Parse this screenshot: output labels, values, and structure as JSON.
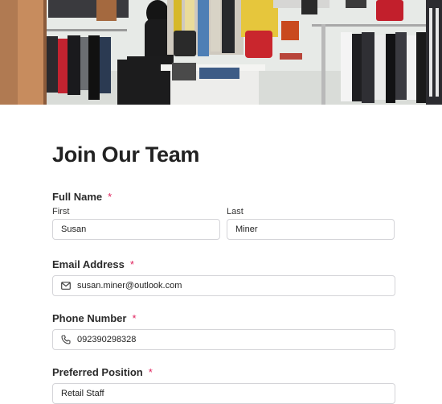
{
  "form": {
    "title": "Join Our Team",
    "required_mark": "*",
    "full_name": {
      "label": "Full Name",
      "first_label": "First",
      "first_value": "Susan",
      "last_label": "Last",
      "last_value": "Miner"
    },
    "email": {
      "label": "Email Address",
      "value": "susan.miner@outlook.com",
      "icon": "envelope-icon"
    },
    "phone": {
      "label": "Phone Number",
      "value": "092390298328",
      "icon": "phone-icon"
    },
    "position": {
      "label": "Preferred Position",
      "value": "Retail Staff"
    }
  },
  "colors": {
    "required": "#e0245e",
    "border": "#d4d4d8"
  }
}
